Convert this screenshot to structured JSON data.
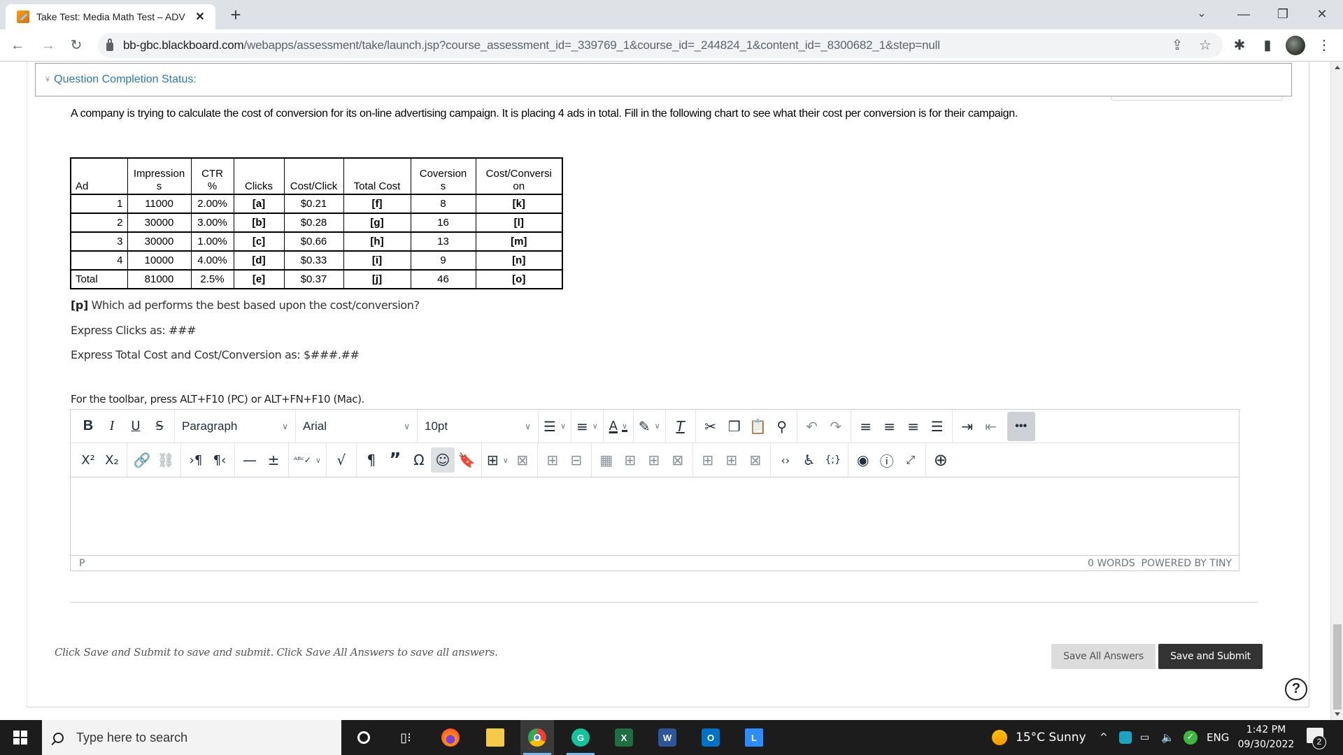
{
  "browser": {
    "tab_title": "Take Test: Media Math Test – ADV",
    "tab_close": "✕",
    "new_tab": "+",
    "url_host": "bb-gbc.blackboard.com",
    "url_path": "/webapps/assessment/take/launch.jsp?course_assessment_id=_339769_1&course_id=_244824_1&content_id=_8300682_1&step=null",
    "icons": {
      "back": "←",
      "forward": "→",
      "reload": "↻",
      "share": "⇪",
      "star": "☆",
      "extensions": "✱",
      "side_panel": "▮",
      "menu": "⋮",
      "tab_search": "⌄",
      "minimize": "—",
      "restore": "❐",
      "close": "✕"
    }
  },
  "page": {
    "question_status_label": "Question Completion Status:",
    "question_status_chevron": "¥",
    "question_text": "A company is trying to calculate the cost of conversion for its on-line advertising campaign.  It is placing 4 ads in total.  Fill in the following chart to see what their cost per conversion is for their campaign.",
    "table": {
      "headers": [
        [
          "Ad"
        ],
        [
          "Impression",
          "s"
        ],
        [
          "CTR",
          "%"
        ],
        [
          "Clicks"
        ],
        [
          "Cost/Click"
        ],
        [
          "Total Cost"
        ],
        [
          "Coversion",
          "s"
        ],
        [
          "Cost/Conversi",
          "on"
        ]
      ],
      "rows": [
        {
          "ad": "1",
          "impressions": "11000",
          "ctr": "2.00%",
          "clicks": "[a]",
          "cost_per_click": "$0.21",
          "total_cost": "[f]",
          "conversions": "8",
          "cost_per_conversion": "[k]"
        },
        {
          "ad": "2",
          "impressions": "30000",
          "ctr": "3.00%",
          "clicks": "[b]",
          "cost_per_click": "$0.28",
          "total_cost": "[g]",
          "conversions": "16",
          "cost_per_conversion": "[l]"
        },
        {
          "ad": "3",
          "impressions": "30000",
          "ctr": "1.00%",
          "clicks": "[c]",
          "cost_per_click": "$0.66",
          "total_cost": "[h]",
          "conversions": "13",
          "cost_per_conversion": "[m]"
        },
        {
          "ad": "4",
          "impressions": "10000",
          "ctr": "4.00%",
          "clicks": "[d]",
          "cost_per_click": "$0.33",
          "total_cost": "[i]",
          "conversions": "9",
          "cost_per_conversion": "[n]"
        },
        {
          "ad": "Total",
          "impressions": "81000",
          "ctr": "2.5%",
          "clicks": "[e]",
          "cost_per_click": "$0.37",
          "total_cost": "[j]",
          "conversions": "46",
          "cost_per_conversion": "[o]"
        }
      ]
    },
    "p_label": "[p]",
    "p_question": " Which ad performs the best based upon the cost/conversion?",
    "express_clicks": "Express Clicks as: ###",
    "express_cost": "Express Total Cost and Cost/Conversion as: $###.##",
    "toolbar_hint": "For the toolbar, press ALT+F10 (PC) or ALT+FN+F10 (Mac).",
    "editor": {
      "block_format": "Paragraph",
      "font_family": "Arial",
      "font_size": "10pt",
      "path": "P",
      "word_count": "0 WORDS",
      "powered_by": "POWERED BY TINY",
      "body_value": ""
    },
    "instructions": "Click Save and Submit to save and submit. Click Save All Answers to save all answers.",
    "save_all_label": "Save All Answers",
    "save_submit_label": "Save and Submit",
    "help_icon": "?"
  },
  "taskbar": {
    "search_placeholder": "Type here to search",
    "apps": [
      "Cortana",
      "Task View",
      "Firefox",
      "File Explorer",
      "Chrome",
      "Grammarly",
      "Excel",
      "Word",
      "Outlook",
      "L App"
    ],
    "weather": "15°C  Sunny",
    "language": "ENG",
    "time": "1:42 PM",
    "date": "09/30/2022",
    "notification_count": "2",
    "tray_chevron": "^",
    "volume": "🔈"
  }
}
